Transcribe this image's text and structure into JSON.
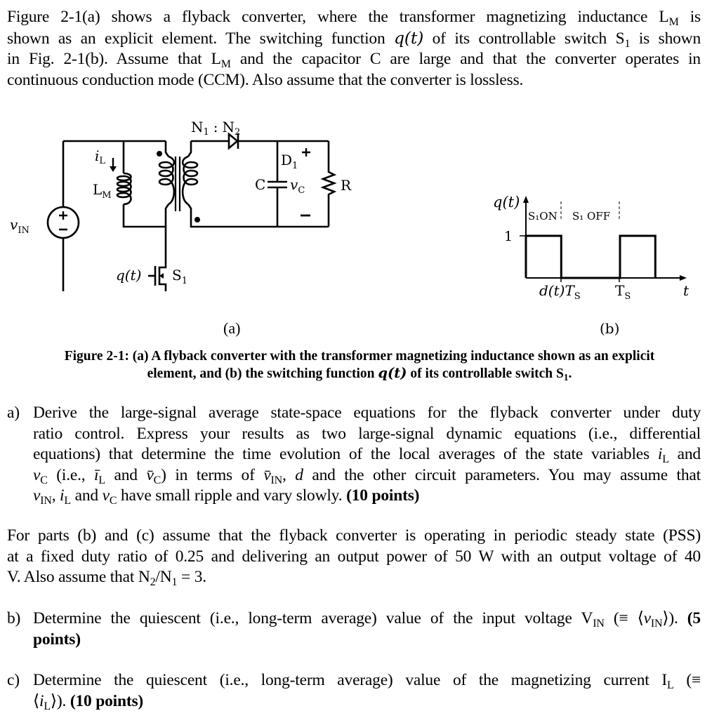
{
  "intro": {
    "lines": [
      [
        "Figure 2-1(a) shows a flyback converter, where the transformer magnetizing inductance L",
        "M",
        " is"
      ],
      [
        "shown as an explicit element. The switching function ",
        "q(t)",
        " of its controllable switch S",
        "1",
        " is shown"
      ],
      [
        "in Fig. 2-1(b). Assume that L",
        "M",
        " and the capacitor C are large and that the converter operates in"
      ],
      [
        "continuous conduction mode (CCM). Also assume that the converter is lossless."
      ]
    ]
  },
  "figure_a": {
    "ratio_label": "N₁ : N₂",
    "n1": "N",
    "n1_sub": "1",
    "colon": ":",
    "n2": "N",
    "n2_sub": "2",
    "diode": "D",
    "diode_sub": "1",
    "capacitor": "C",
    "vc": "v",
    "vc_sub": "C",
    "plus": "+",
    "minus": "−",
    "resistor": "R",
    "il": "i",
    "il_sub": "L",
    "lm": "L",
    "lm_sub": "M",
    "vin": "v",
    "vin_sub": "IN",
    "gate": "q(t)",
    "switch": "S",
    "switch_sub": "1",
    "label": "(a)"
  },
  "figure_b": {
    "ylabel": "q(t)",
    "one": "1",
    "on": "S₁ON",
    "off": "S₁ OFF",
    "tick1": "d(t)T",
    "tick1_sub": "S",
    "tick2": "T",
    "tick2_sub": "S",
    "xlabel": "t",
    "label": "(b)"
  },
  "caption": {
    "line1": "Figure 2-1: (a) A flyback converter with the transformer magnetizing inductance shown as an explicit",
    "line2_a": "element, and (b) the switching function ",
    "line2_q": "q(t)",
    "line2_b": " of its controllable switch S",
    "line2_sub": "1",
    "line2_end": "."
  },
  "questions": {
    "a": {
      "label": "a)",
      "l1": "Derive the large-signal average state-space equations for the flyback converter under duty",
      "l2": "ratio control.  Express your results as two large-signal dynamic equations (i.e., differential",
      "l3a": "equations) that determine the time evolution of the local averages of the state variables ",
      "l3b": " and",
      "l4a": " (i.e., ",
      "l4b": " and ",
      "l4c": ") in terms of ",
      "l4d": ", ",
      "l4e": " and the other circuit parameters. You may assume that",
      "l5a": ", ",
      "l5b": " and ",
      "l5c": " have small ripple and vary slowly. ",
      "points": "(10 points)"
    },
    "pss": {
      "l1": "For parts (b) and (c) assume that the flyback converter is operating in periodic steady state (PSS)",
      "l2": "at a fixed duty ratio of 0.25 and delivering an output power of 50 W with an output voltage of 40",
      "l3a": "V. Also assume that N",
      "l3s1": "2",
      "l3b": "/N",
      "l3s2": "1",
      "l3c": " = 3."
    },
    "b": {
      "label": "b)",
      "l1a": "Determine the quiescent (i.e., long-term average) value of the input voltage V",
      "l1sub": "IN",
      "l1b": " (≡ ⟨",
      "l1c": "⟩). ",
      "points_a": "(5",
      "points_b": "points)"
    },
    "c": {
      "label": "c)",
      "l1a": "Determine the quiescent (i.e., long-term average) value of the magnetizing current I",
      "l1sub": "L",
      "l1b": " (≡",
      "l2a": "⟨",
      "l2b": "⟩). ",
      "points": "(10 points)"
    }
  },
  "symbols": {
    "iL": "i",
    "iL_sub": "L",
    "vC": "v",
    "vC_sub": "C",
    "vIN": "v",
    "vIN_sub": "IN",
    "iLbar": "ī",
    "vCbar": "v̄",
    "vINbar": "v̄",
    "d": "d"
  },
  "chart_data": {
    "type": "line",
    "title": "",
    "xlabel": "t",
    "ylabel": "q(t)",
    "x_ticks": [
      "d(t)T_S",
      "T_S"
    ],
    "y_ticks": [
      "1"
    ],
    "annotations": [
      "S1 ON",
      "S1 OFF"
    ],
    "series": [
      {
        "name": "q(t)",
        "x": [
          0,
          0,
          0.6,
          0.6,
          1.6,
          1.6,
          2.2,
          2.2
        ],
        "y": [
          0,
          1,
          1,
          0,
          0,
          1,
          1,
          0
        ]
      }
    ],
    "note": "x in units where d(t)T_S = 0.6 and T_S = 1.6 as drawn (schematic, not to scale)"
  }
}
